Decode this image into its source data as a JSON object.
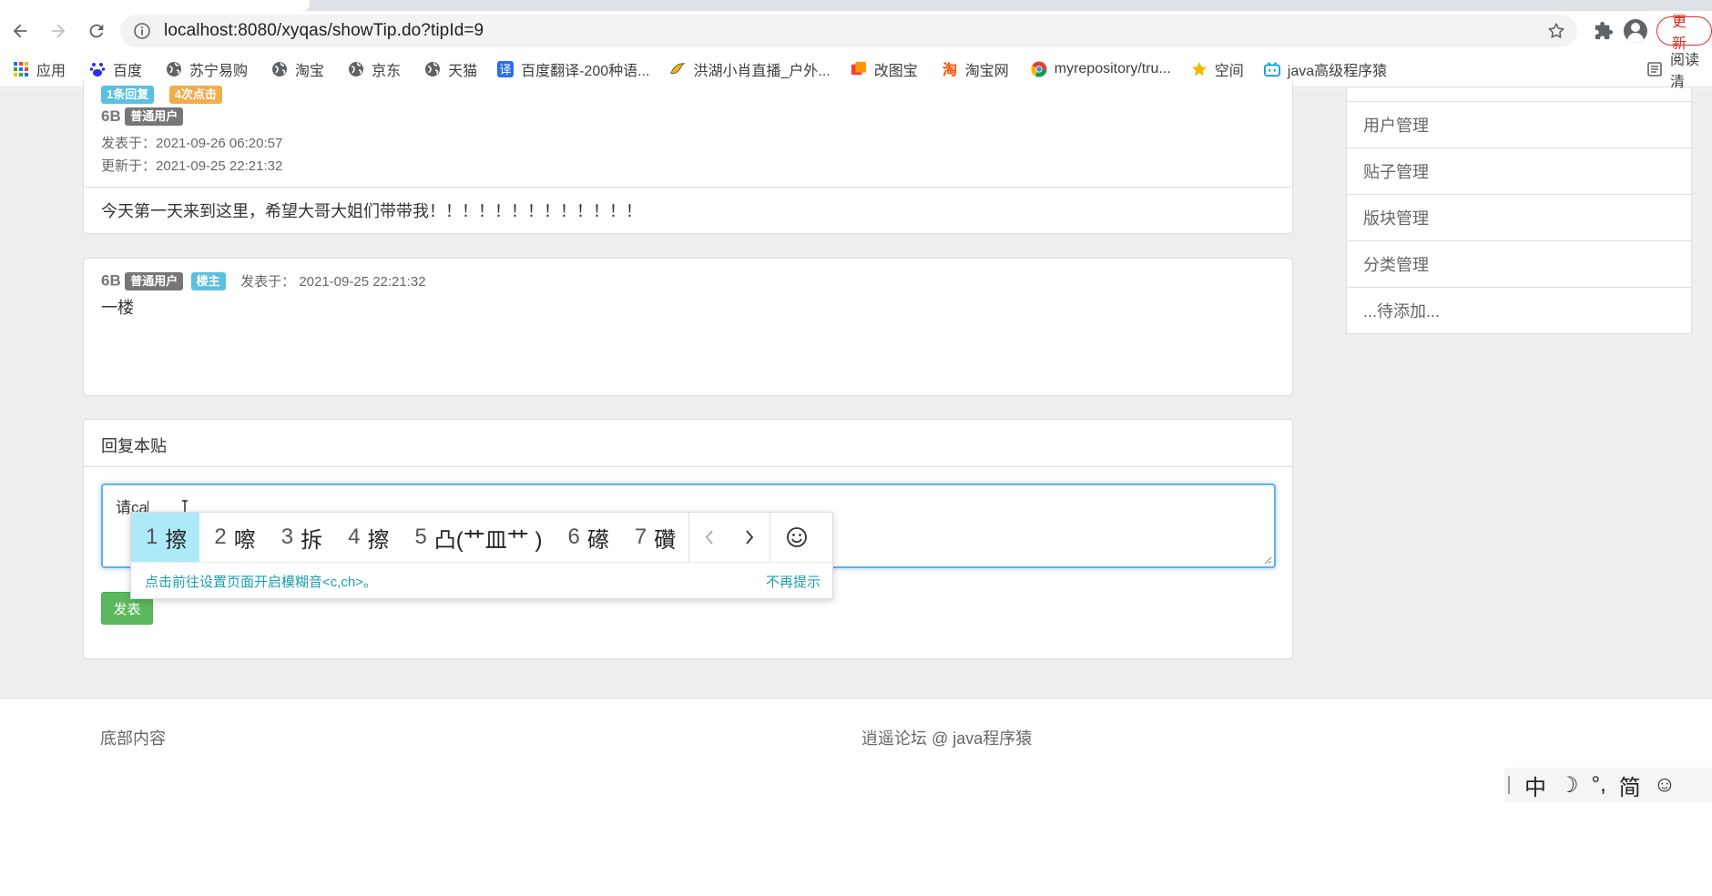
{
  "browser": {
    "url": "localhost:8080/xyqas/showTip.do?tipId=9",
    "update_label": "更新"
  },
  "bookmarks": [
    {
      "label": "应用",
      "icon": "apps-grid-icon"
    },
    {
      "label": "百度",
      "icon": "baidu-paw-icon"
    },
    {
      "label": "苏宁易购",
      "icon": "globe-icon"
    },
    {
      "label": "淘宝",
      "icon": "globe-icon"
    },
    {
      "label": "京东",
      "icon": "globe-icon"
    },
    {
      "label": "天猫",
      "icon": "globe-icon"
    },
    {
      "label": "百度翻译-200种语...",
      "icon": "translate-icon"
    },
    {
      "label": "洪湖小肖直播_户外...",
      "icon": "bird-icon"
    },
    {
      "label": "改图宝",
      "icon": "image-tool-icon"
    },
    {
      "label": "淘宝网",
      "icon": "taobao-icon"
    },
    {
      "label": "myrepository/tru...",
      "icon": "chrome-icon"
    },
    {
      "label": "空间",
      "icon": "qzone-icon"
    },
    {
      "label": "java高级程序猿",
      "icon": "bilibili-icon"
    }
  ],
  "reading_list_label": "阅读清",
  "post": {
    "reply_count": "1条回复",
    "click_count": "4次点击",
    "author": "6B",
    "role": "普通用户",
    "posted_label": "发表于：",
    "posted_at": "2021-09-26 06:20:57",
    "updated_label": "更新于：",
    "updated_at": "2021-09-25 22:21:32",
    "content": "今天第一天来到这里，希望大哥大姐们带带我！！！！！！！！！！！！！"
  },
  "reply": {
    "author": "6B",
    "role": "普通用户",
    "owner_tag": "楼主",
    "posted_label": "发表于：",
    "posted_at": "2021-09-25 22:21:32",
    "content": "一楼"
  },
  "reply_form": {
    "title": "回复本贴",
    "input_value": "请ca",
    "submit_label": "发表"
  },
  "ime": {
    "candidates": [
      {
        "n": "1",
        "text": "擦"
      },
      {
        "n": "2",
        "text": "嚓"
      },
      {
        "n": "3",
        "text": "拆"
      },
      {
        "n": "4",
        "text": "擦"
      },
      {
        "n": "5",
        "text": "凸(艹皿艹 )"
      },
      {
        "n": "6",
        "text": "礤"
      },
      {
        "n": "7",
        "text": "礸"
      }
    ],
    "hint": "点击前往设置页面开启模糊音<c,ch>。",
    "dismiss": "不再提示",
    "status_bar": [
      "中",
      "☽",
      "°,",
      "简",
      "☺"
    ]
  },
  "sidebar": {
    "items": [
      "用户管理",
      "贴子管理",
      "版块管理",
      "分类管理",
      "...待添加..."
    ]
  },
  "footer": {
    "left": "底部内容",
    "center": "逍遥论坛 @ java程序猿"
  },
  "colors": {
    "label_gray": "#777777",
    "label_info": "#5bc0de",
    "label_warning": "#f0ad4e",
    "button_success": "#5cb85c",
    "page_bg": "#eeeeee",
    "ime_selected": "#aee9f7"
  }
}
